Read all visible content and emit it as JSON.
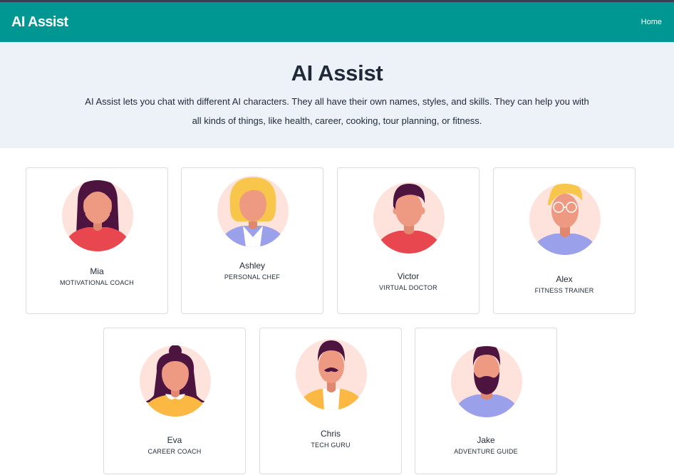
{
  "nav": {
    "brand": "AI Assist",
    "home_label": "Home"
  },
  "hero": {
    "title": "AI Assist",
    "description": "AI Assist lets you chat with different AI characters. They all have their own names, styles, and skills. They can help you with all kinds of things, like health, career, cooking, tour planning, or fitness."
  },
  "characters": [
    {
      "name": "Mia",
      "role": "MOTIVATIONAL COACH",
      "avatar_icon": "woman-long-hair-avatar-icon"
    },
    {
      "name": "Ashley",
      "role": "PERSONAL CHEF",
      "avatar_icon": "woman-blonde-bob-avatar-icon"
    },
    {
      "name": "Victor",
      "role": "VIRTUAL DOCTOR",
      "avatar_icon": "man-short-hair-avatar-icon"
    },
    {
      "name": "Alex",
      "role": "FITNESS TRAINER",
      "avatar_icon": "man-glasses-avatar-icon"
    },
    {
      "name": "Eva",
      "role": "CAREER COACH",
      "avatar_icon": "woman-bun-avatar-icon"
    },
    {
      "name": "Chris",
      "role": "TECH GURU",
      "avatar_icon": "man-mustache-avatar-icon"
    },
    {
      "name": "Jake",
      "role": "ADVENTURE GUIDE",
      "avatar_icon": "man-beard-avatar-icon"
    }
  ],
  "colors": {
    "navbar": "#009792",
    "hero_bg": "#edf1f8",
    "avatar_bg": "#fde3dc",
    "skin": "#ee9a83",
    "hair_dark": "#4e1440",
    "hair_blonde": "#f8c64b",
    "shirt_red": "#e8474f",
    "shirt_lavender": "#9aa0e9",
    "shirt_yellow": "#fbb843"
  }
}
